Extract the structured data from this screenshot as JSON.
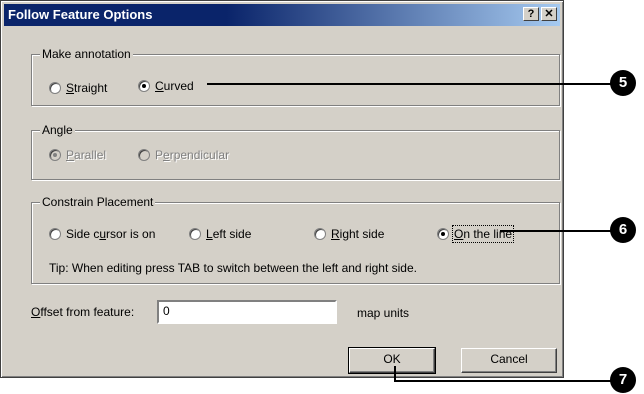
{
  "dialog": {
    "title": "Follow Feature Options",
    "help_button": "?",
    "close_button": "✕"
  },
  "make_annotation": {
    "legend": "Make annotation",
    "straight": {
      "prefix": "",
      "mnemonic": "S",
      "rest": "traight",
      "selected": false
    },
    "curved": {
      "prefix": "",
      "mnemonic": "C",
      "rest": "urved",
      "selected": true
    }
  },
  "angle": {
    "legend": "Angle",
    "parallel": {
      "prefix": "",
      "mnemonic": "P",
      "rest": "arallel",
      "selected": true
    },
    "perpendicular": {
      "prefix": "P",
      "mnemonic": "e",
      "rest": "rpendicular",
      "selected": false
    }
  },
  "constrain_placement": {
    "legend": "Constrain Placement",
    "side_cursor": {
      "prefix": "Side c",
      "mnemonic": "u",
      "rest": "rsor is on",
      "selected": false
    },
    "left_side": {
      "prefix": "",
      "mnemonic": "L",
      "rest": "eft side",
      "selected": false
    },
    "right_side": {
      "prefix": "",
      "mnemonic": "R",
      "rest": "ight side",
      "selected": false
    },
    "on_the_line": {
      "prefix": "",
      "mnemonic": "O",
      "rest": "n the line",
      "selected": true
    },
    "tip": "Tip:  When editing press TAB to switch between the left and right side."
  },
  "offset": {
    "label_mnemonic": "O",
    "label_rest": "ffset from feature:",
    "value": "0",
    "units": "map units"
  },
  "buttons": {
    "ok": "OK",
    "cancel": "Cancel"
  },
  "callouts": [
    "5",
    "6",
    "7"
  ]
}
